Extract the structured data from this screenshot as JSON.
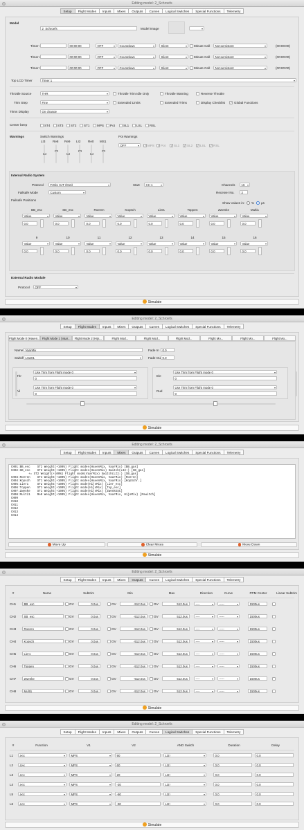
{
  "window_title": "Editing model: 2_Schroefs",
  "tabs": [
    "Setup",
    "Flight Modes",
    "Inputs",
    "Mixes",
    "Outputs",
    "Curves",
    "Logical Switches",
    "Special Functions",
    "Telemetry"
  ],
  "simulate_label": "Simulate",
  "setup": {
    "model_label": "Model",
    "model_name": "2_Schroefs",
    "model_image_label": "Model Image",
    "timers": [
      {
        "label": "Timer 1",
        "time": "00:00:00",
        "mode": "OFF",
        "direction": "Countdown",
        "beep": "Silent",
        "minute_call": "Minute Call",
        "persist": "Not persistent",
        "value": "(00:00:00)"
      },
      {
        "label": "Timer 2",
        "time": "00:00:00",
        "mode": "OFF",
        "direction": "Countdown",
        "beep": "Silent",
        "minute_call": "Minute Call",
        "persist": "Not persistent",
        "value": "(00:00:00)"
      },
      {
        "label": "Timer 3",
        "time": "00:00:00",
        "mode": "OFF",
        "direction": "Countdown",
        "beep": "Silent",
        "minute_call": "Minute Call",
        "persist": "Not persistent",
        "value": "(00:00:00)"
      }
    ],
    "top_lcd_label": "Top LCD Timer",
    "top_lcd_value": "Timer 1",
    "throttle_source_label": "Throttle Source",
    "throttle_source_value": "THR",
    "throttle_trim_idle": "Throttle Trim Idle Only",
    "throttle_warning": "Throttle Warning",
    "reverse_throttle": "Reverse Throttle",
    "trim_step_label": "Trim Step",
    "trim_step_value": "Fine",
    "extended_limits": "Extended Limits",
    "extended_trims": "Extended Trims",
    "display_checklist": "Display Checklist",
    "global_functions": "Global Functions",
    "trims_display_label": "Trims Display",
    "trims_display_value": "On change",
    "center_beep_label": "Center beep",
    "center_beep_items": [
      "ST4",
      "ST3",
      "ST2",
      "ST1",
      "MPS",
      "Pot",
      "SL1",
      "LSL",
      "RSL"
    ],
    "warnings_label": "Warnings",
    "switch_warnings_label": "Switch Warnings",
    "switch_warning_items": [
      "LI3",
      "Re8",
      "Re9",
      "LI2",
      "Re0",
      "MS1"
    ],
    "pot_warnings_label": "Pot Warnings",
    "pot_warning_mode": "OFF",
    "pot_warning_items": [
      "MPS",
      "Pot",
      "SL1",
      "SL2",
      "LSL",
      "RSL"
    ],
    "internal_radio_label": "Internal Radio System",
    "protocol_label": "Protocol",
    "protocol_value": "FrSky XJT (D16)",
    "start_label": "Start",
    "start_value": "CH 1",
    "channels_label": "Channels",
    "channels_value": "16",
    "failsafe_mode_label": "Failsafe Mode",
    "failsafe_mode_value": "Custom",
    "receiver_no_label": "Receiver No.",
    "receiver_no_value": "2",
    "failsafe_positions_label": "Failsafe Positions",
    "show_values_label": "Show values in:",
    "show_values_pct": "%",
    "show_values_us": "μs",
    "failsafe_row1": [
      "BB_esc",
      "SB_esc",
      "Roeren",
      "Kopsch",
      "Lier1",
      "Toppen",
      "Zwenke",
      "Multi1"
    ],
    "failsafe_row2": [
      "9",
      "10",
      "11",
      "12",
      "13",
      "14",
      "15",
      "16"
    ],
    "failsafe_value": "Value",
    "failsafe_num": "0,0",
    "external_module_label": "External Radio Module",
    "ext_protocol_label": "Protocol",
    "ext_protocol_value": "OFF"
  },
  "flightmodes": {
    "fm_tabs": [
      "Flight Mode 0 (Haven...",
      "Flight Mode 1 (Vaar...",
      "Flight Mode 2 (Hijs...",
      "Flight Mod...",
      "Flight Mod...",
      "Flight Mod...",
      "Flight Mo...",
      "Flight Mo...",
      "Flight Mo..."
    ],
    "name_label": "Name",
    "name_value": "VaarMix",
    "switch_label": "Switch",
    "switch_value": "LSw01",
    "fade_in_label": "Fade In",
    "fade_in_value": "0,0",
    "fade_out_label": "Fade Out",
    "fade_out_value": "0,0",
    "trim_option": "Use Trim from Flight mode 0",
    "trim_value": "0",
    "trims": [
      "Thr",
      "Ail",
      "Ele",
      "Rud"
    ]
  },
  "mixes": {
    "lines": [
      "CH01:BB_esc    ST2 Weight(+100%) Flight modes(HavenMix, VaarMix) [BB_gas]",
      "CH02:SB_esc    ST3 Weight(+100%) Flight modes(HavenMix) Switch(LI2↑) [SB_gas]",
      "          += ST2 Weight(+100%) Flight mode(VaarMix) Switch(LI2↓) [SB_gas]",
      "CH03:Roeren    ST4 Weight(+100%) Flight modes(HavenMix, VaarMix) [Roeren]",
      "CH04:Kopsch    ST1 Weight(+100%) Flight modes(HavenMix, VaarMix) [KopSchr.]",
      "CH05:Lier1     ST2 Weight(+100%) Flight mode(HijsMix) [Lier_esc]",
      "CH06:Toppen    ST1 Weight(+100%) Flight mode(HijsMix) [Top_esc]",
      "CH07:Zwenke    ST1 Weight(+100%) Flight mode(HijsMix) [ZwenkESC]",
      "CH08:Multi1    Re0 Weight(+100%) Flight modes(HavenMix, VaarMix, HijsMix) [Mswitch]",
      "CH09",
      "CH10",
      "CH11",
      "CH12",
      "CH13",
      "CH14"
    ],
    "move_up": "Move Up",
    "clear_mixes": "Clear Mixes",
    "move_down": "Move Down"
  },
  "outputs": {
    "headers": [
      "#",
      "Name",
      "Subtrim",
      "Min",
      "Max",
      "Direction",
      "Curve",
      "PPM Center",
      "Linear Subtrim"
    ],
    "gv_label": "GV",
    "rows": [
      {
        "ch": "CH1",
        "name": "BB_esc",
        "subtrim": "0,0us",
        "min": "-512,0us",
        "max": "512,0us",
        "dir": "----",
        "curve": "-----",
        "ppm": "1500us"
      },
      {
        "ch": "CH2",
        "name": "SB_esc",
        "subtrim": "0,0us",
        "min": "-512,0us",
        "max": "512,0us",
        "dir": "----",
        "curve": "-----",
        "ppm": "1500us"
      },
      {
        "ch": "CH3",
        "name": "Roeren",
        "subtrim": "0,0us",
        "min": "-512,0us",
        "max": "512,0us",
        "dir": "----",
        "curve": "-----",
        "ppm": "1500us"
      },
      {
        "ch": "CH4",
        "name": "Kopsch",
        "subtrim": "0,0us",
        "min": "-512,0us",
        "max": "512,0us",
        "dir": "----",
        "curve": "-----",
        "ppm": "1500us"
      },
      {
        "ch": "CH5",
        "name": "Lier1",
        "subtrim": "0,0us",
        "min": "-512,0us",
        "max": "512,0us",
        "dir": "----",
        "curve": "-----",
        "ppm": "1500us"
      },
      {
        "ch": "CH6",
        "name": "Toppen",
        "subtrim": "0,0us",
        "min": "-512,0us",
        "max": "512,0us",
        "dir": "----",
        "curve": "-----",
        "ppm": "1500us"
      },
      {
        "ch": "CH7",
        "name": "Zwenke",
        "subtrim": "0,0us",
        "min": "-512,0us",
        "max": "512,0us",
        "dir": "----",
        "curve": "-----",
        "ppm": "1500us"
      },
      {
        "ch": "CH8",
        "name": "Multi1",
        "subtrim": "0,0us",
        "min": "-512,0us",
        "max": "512,0us",
        "dir": "----",
        "curve": "-----",
        "ppm": "1500us"
      }
    ]
  },
  "logical": {
    "headers": [
      "#",
      "Function",
      "V1",
      "V2",
      "AND Switch",
      "Duration",
      "Delay"
    ],
    "rows": [
      {
        "id": "L1",
        "func": "a<x",
        "v1": "MPS",
        "v2": "90",
        "and": "LI2↑",
        "dur": "0,0",
        "delay": "0,0"
      },
      {
        "id": "L2",
        "func": "a>x",
        "v1": "MPS",
        "v2": "60",
        "and": "LI2↑",
        "dur": "0,0",
        "delay": "0,0"
      },
      {
        "id": "L3",
        "func": "a>x",
        "v1": "MPS",
        "v2": "20",
        "and": "LI2↑",
        "dur": "0,0",
        "delay": "0,0"
      },
      {
        "id": "L4",
        "func": "a<x",
        "v1": "MPS",
        "v2": "-20",
        "and": "LI2↑",
        "dur": "0,0",
        "delay": "0,0"
      },
      {
        "id": "L5",
        "func": "a<x",
        "v1": "MPS",
        "v2": "-60",
        "and": "LI2↑",
        "dur": "0,0",
        "delay": "0,0"
      },
      {
        "id": "L6",
        "func": "a<x",
        "v1": "MPS",
        "v2": "-90",
        "and": "LI2↑",
        "dur": "0,0",
        "delay": "0,0"
      }
    ]
  }
}
